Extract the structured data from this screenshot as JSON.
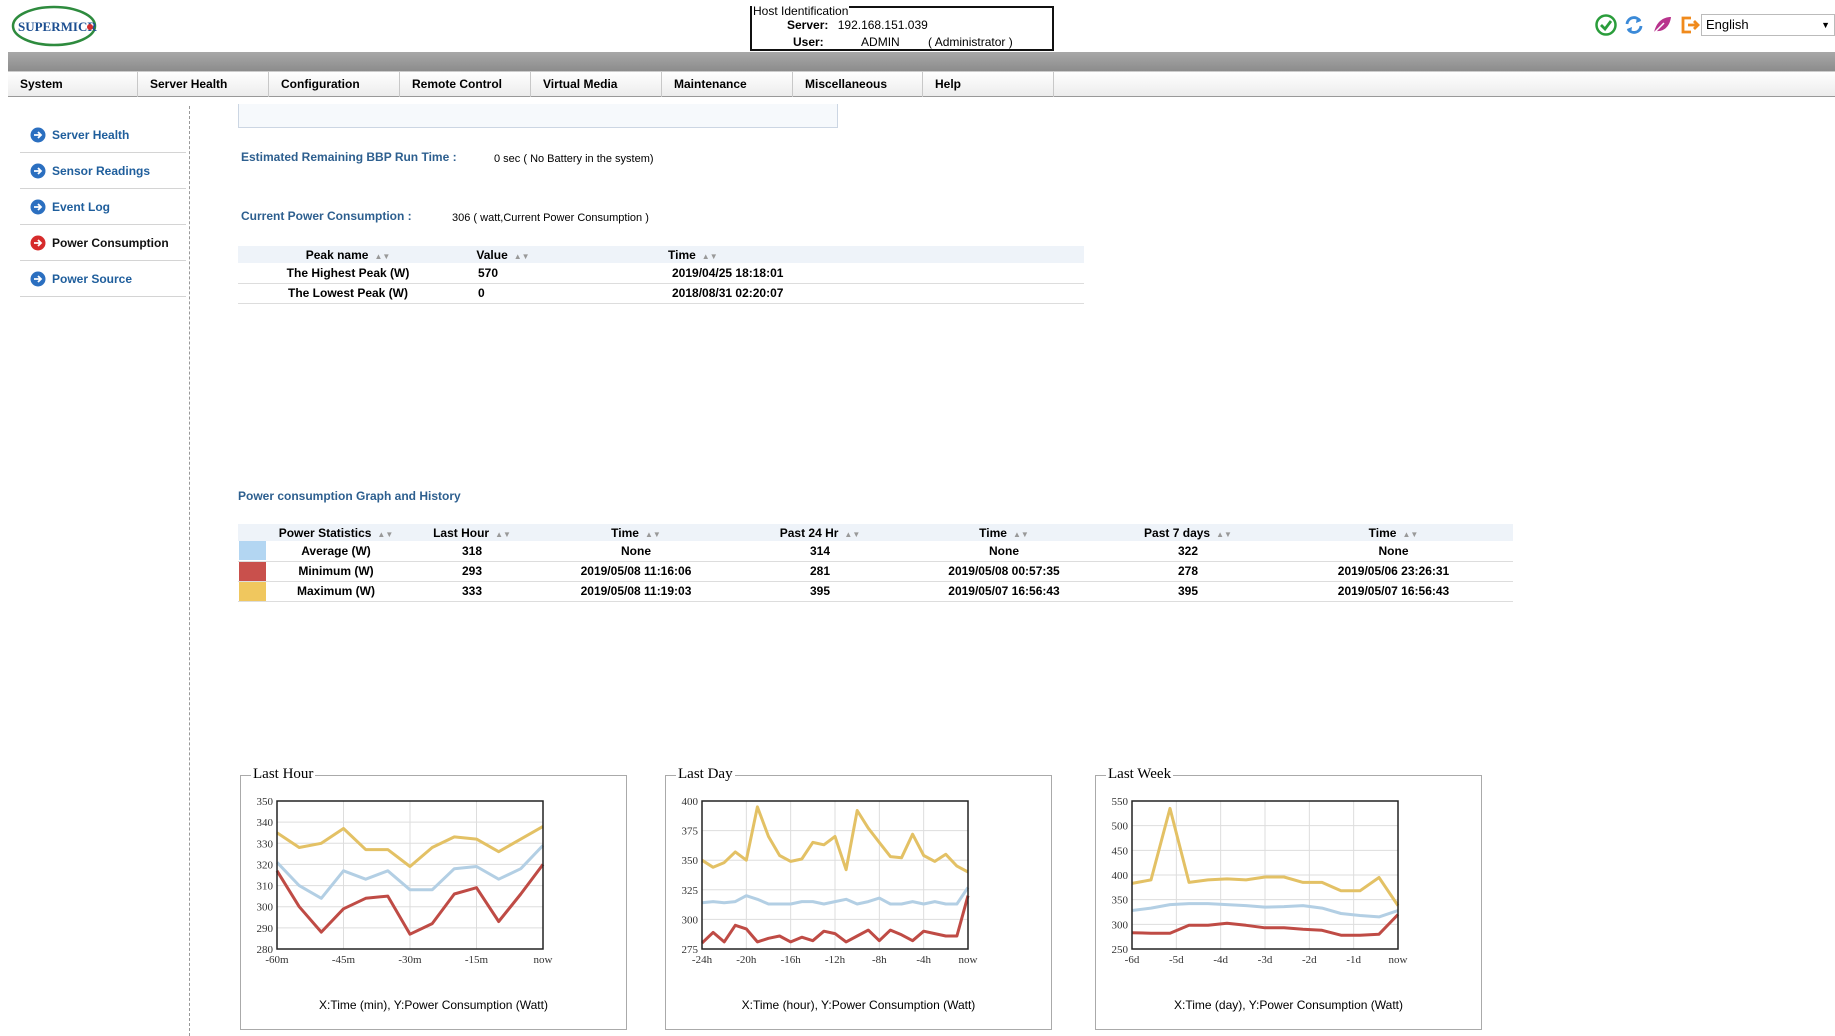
{
  "header": {
    "logo_text": "SUPERMICRO",
    "host_id_legend": "Host Identification",
    "server_label": "Server:",
    "server_value": "192.168.151.039",
    "user_label": "User:",
    "user_value": "ADMIN",
    "user_role": "( Administrator )",
    "language": "English",
    "icons": [
      "status-ok-icon",
      "refresh-icon",
      "leaf-icon",
      "logout-icon"
    ]
  },
  "menu": [
    "System",
    "Server Health",
    "Configuration",
    "Remote Control",
    "Virtual Media",
    "Maintenance",
    "Miscellaneous",
    "Help"
  ],
  "sidebar": {
    "items": [
      {
        "label": "Server Health",
        "active": false
      },
      {
        "label": "Sensor Readings",
        "active": false
      },
      {
        "label": "Event Log",
        "active": false
      },
      {
        "label": "Power Consumption",
        "active": true
      },
      {
        "label": "Power Source",
        "active": false
      }
    ]
  },
  "main": {
    "bbp_label": "Estimated Remaining BBP Run Time :",
    "bbp_value": "0 sec ( No Battery in the system)",
    "current_label": "Current Power Consumption :",
    "current_value": "306 ( watt,Current Power Consumption )",
    "peak_table": {
      "headers": [
        "Peak name",
        "Value",
        "Time"
      ],
      "rows": [
        [
          "The Highest Peak (W)",
          "570",
          "2019/04/25 18:18:01"
        ],
        [
          "The Lowest Peak (W)",
          "0",
          "2018/08/31 02:20:07"
        ]
      ]
    },
    "graph_title": "Power consumption Graph and History",
    "stats_table": {
      "headers": [
        "Power Statistics",
        "Last Hour",
        "Time",
        "Past 24 Hr",
        "Time",
        "Past 7 days",
        "Time"
      ],
      "rows": [
        {
          "color": "#b3d6f2",
          "cells": [
            "Average (W)",
            "318",
            "None",
            "314",
            "None",
            "322",
            "None"
          ]
        },
        {
          "color": "#c9504c",
          "cells": [
            "Minimum (W)",
            "293",
            "2019/05/08 11:16:06",
            "281",
            "2019/05/08 00:57:35",
            "278",
            "2019/05/06 23:26:31"
          ]
        },
        {
          "color": "#f0c75e",
          "cells": [
            "Maximum (W)",
            "333",
            "2019/05/08 11:19:03",
            "395",
            "2019/05/07 16:56:43",
            "395",
            "2019/05/07 16:56:43"
          ]
        }
      ]
    }
  },
  "chart_data": [
    {
      "type": "line",
      "title": "Last Hour",
      "xlabel": "X:Time (min), Y:Power Consumption (Watt)",
      "x_ticks": [
        "-60m",
        "-45m",
        "-30m",
        "-15m",
        "now"
      ],
      "y_ticks": [
        280,
        290,
        300,
        310,
        320,
        330,
        340,
        350
      ],
      "ylim": [
        280,
        350
      ],
      "grid": true,
      "series": [
        {
          "color": "#b3cfe4",
          "values": [
            321,
            310,
            304,
            317,
            313,
            317,
            308,
            308,
            318,
            319,
            313,
            318,
            329
          ]
        },
        {
          "color": "#bf4b45",
          "values": [
            317,
            300,
            288,
            299,
            304,
            305,
            287,
            292,
            306,
            309,
            293,
            306,
            320
          ]
        },
        {
          "color": "#e3c165",
          "values": [
            335,
            328,
            330,
            337,
            327,
            327,
            319,
            328,
            333,
            332,
            326,
            332,
            338
          ]
        }
      ]
    },
    {
      "type": "line",
      "title": "Last Day",
      "xlabel": "X:Time (hour), Y:Power Consumption (Watt)",
      "x_ticks": [
        "-24h",
        "-20h",
        "-16h",
        "-12h",
        "-8h",
        "-4h",
        "now"
      ],
      "y_ticks": [
        275,
        300,
        325,
        350,
        375,
        400
      ],
      "ylim": [
        275,
        400
      ],
      "grid": true,
      "series": [
        {
          "color": "#b3cfe4",
          "values": [
            314,
            315,
            314,
            315,
            320,
            317,
            313,
            313,
            313,
            315,
            315,
            313,
            315,
            317,
            313,
            315,
            318,
            313,
            313,
            315,
            313,
            315,
            313,
            313,
            327
          ]
        },
        {
          "color": "#bf4b45",
          "values": [
            280,
            289,
            281,
            295,
            292,
            281,
            284,
            286,
            281,
            285,
            282,
            290,
            288,
            281,
            286,
            291,
            282,
            291,
            287,
            282,
            290,
            288,
            286,
            286,
            320
          ]
        },
        {
          "color": "#e3c165",
          "values": [
            350,
            344,
            348,
            357,
            350,
            395,
            370,
            354,
            349,
            351,
            365,
            363,
            370,
            342,
            392,
            377,
            365,
            353,
            352,
            372,
            354,
            349,
            355,
            345,
            340
          ]
        }
      ]
    },
    {
      "type": "line",
      "title": "Last Week",
      "xlabel": "X:Time (day), Y:Power Consumption (Watt)",
      "x_ticks": [
        "-6d",
        "-5d",
        "-4d",
        "-3d",
        "-2d",
        "-1d",
        "now"
      ],
      "y_ticks": [
        250,
        300,
        350,
        400,
        450,
        500,
        550
      ],
      "ylim": [
        250,
        550
      ],
      "grid": true,
      "series": [
        {
          "color": "#b3cfe4",
          "values": [
            328,
            333,
            340,
            342,
            342,
            340,
            338,
            335,
            336,
            338,
            333,
            322,
            318,
            315,
            328
          ]
        },
        {
          "color": "#bf4b45",
          "values": [
            283,
            282,
            282,
            298,
            298,
            302,
            298,
            293,
            293,
            290,
            288,
            278,
            278,
            280,
            320
          ]
        },
        {
          "color": "#e3c165",
          "values": [
            383,
            390,
            535,
            385,
            390,
            392,
            390,
            396,
            396,
            385,
            385,
            368,
            368,
            395,
            338
          ]
        }
      ]
    }
  ]
}
